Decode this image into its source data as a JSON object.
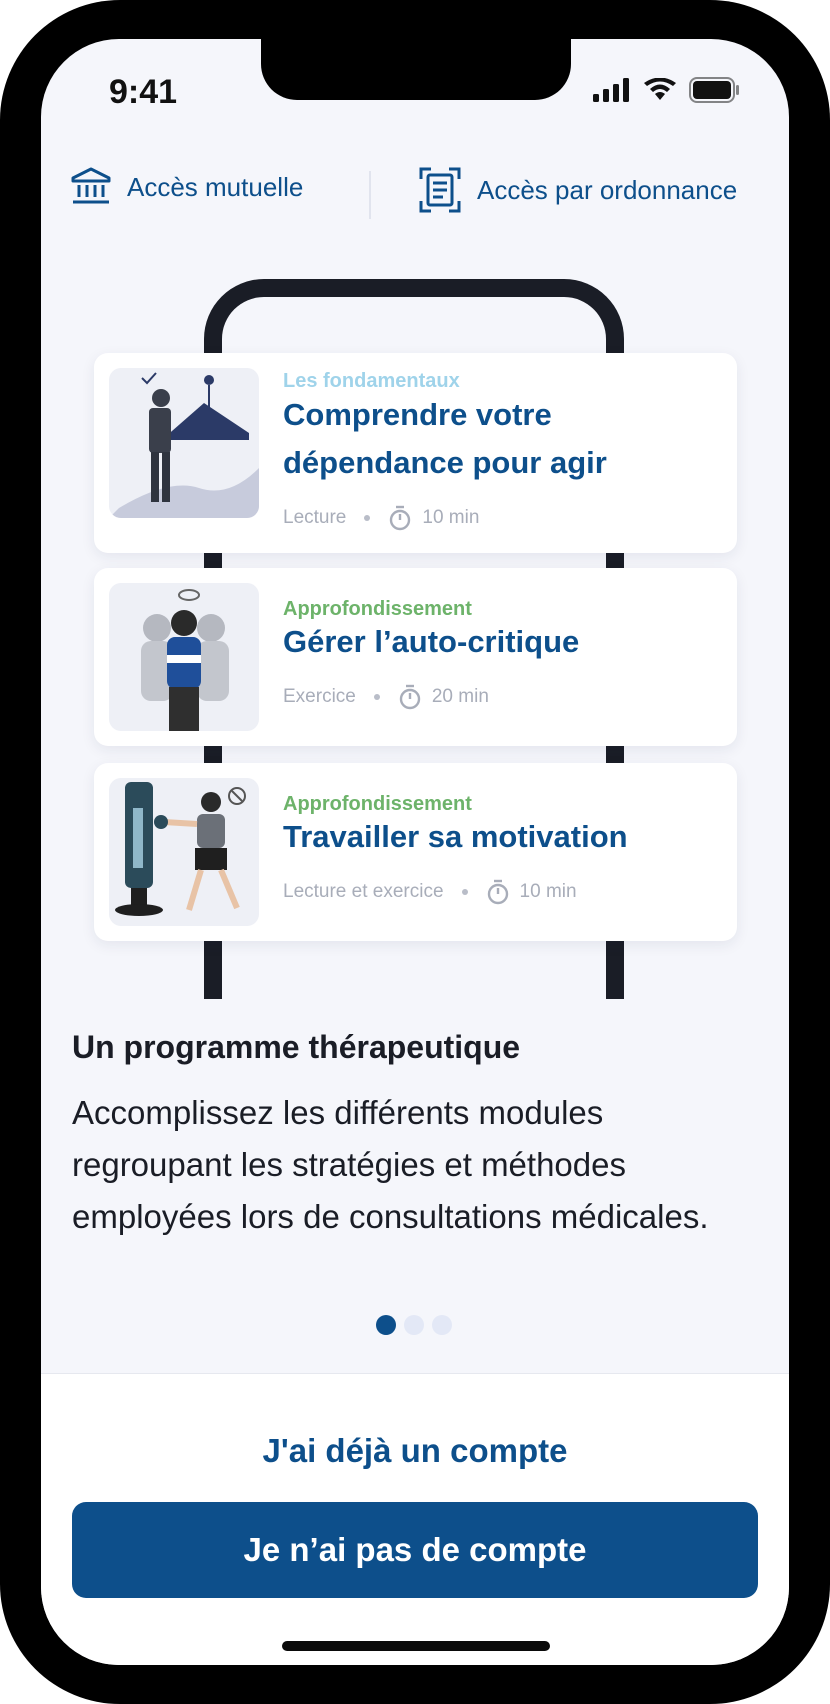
{
  "status_bar": {
    "time": "9:41"
  },
  "access": {
    "mutuelle_label": "Accès mutuelle",
    "ordonnance_label": "Accès par ordonnance"
  },
  "cards": [
    {
      "category": "Les fondamentaux",
      "category_color": "#9fd3ea",
      "title": "Comprendre votre dépendance pour agir",
      "type": "Lecture",
      "duration": "10 min"
    },
    {
      "category": "Approfondissement",
      "category_color": "#6db36a",
      "title": "Gérer l’auto-critique",
      "type": "Exercice",
      "duration": "20 min"
    },
    {
      "category": "Approfondissement",
      "category_color": "#6db36a",
      "title": "Travailler sa motivation",
      "type": "Lecture et exercice",
      "duration": "10 min"
    }
  ],
  "onboarding": {
    "heading": "Un programme thérapeutique",
    "description": "Accomplissez les différents modules regroupant les stratégies et méthodes employées lors de consultations médicales.",
    "page_indicator": {
      "current": 1,
      "total": 3
    }
  },
  "actions": {
    "login_label": "J'ai déjà un compte",
    "signup_label": "Je n’ai pas de compte"
  },
  "colors": {
    "brand": "#0d4f8b",
    "background": "#f5f6fb"
  }
}
